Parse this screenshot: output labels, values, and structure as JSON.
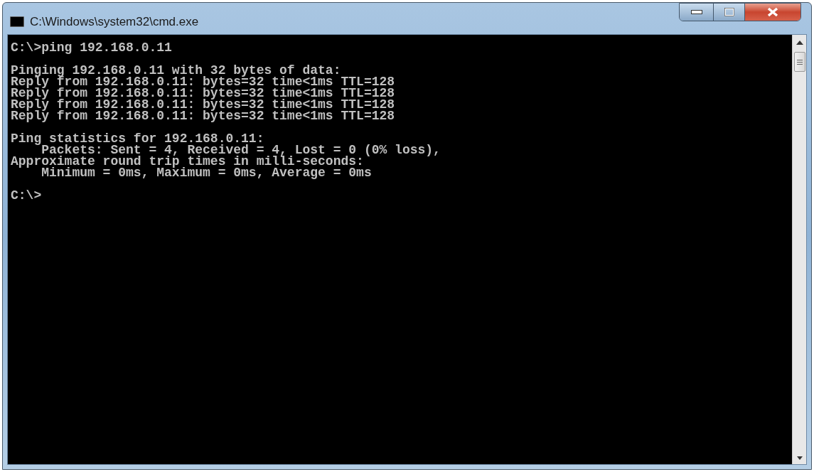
{
  "window": {
    "title": "C:\\Windows\\system32\\cmd.exe"
  },
  "console": {
    "blocks": [
      [
        "C:\\>ping 192.168.0.11"
      ],
      [
        "Pinging 192.168.0.11 with 32 bytes of data:",
        "Reply from 192.168.0.11: bytes=32 time<1ms TTL=128",
        "Reply from 192.168.0.11: bytes=32 time<1ms TTL=128",
        "Reply from 192.168.0.11: bytes=32 time<1ms TTL=128",
        "Reply from 192.168.0.11: bytes=32 time<1ms TTL=128"
      ],
      [
        "Ping statistics for 192.168.0.11:",
        "    Packets: Sent = 4, Received = 4, Lost = 0 (0% loss),",
        "Approximate round trip times in milli-seconds:",
        "    Minimum = 0ms, Maximum = 0ms, Average = 0ms"
      ],
      [
        "C:\\>"
      ]
    ]
  }
}
